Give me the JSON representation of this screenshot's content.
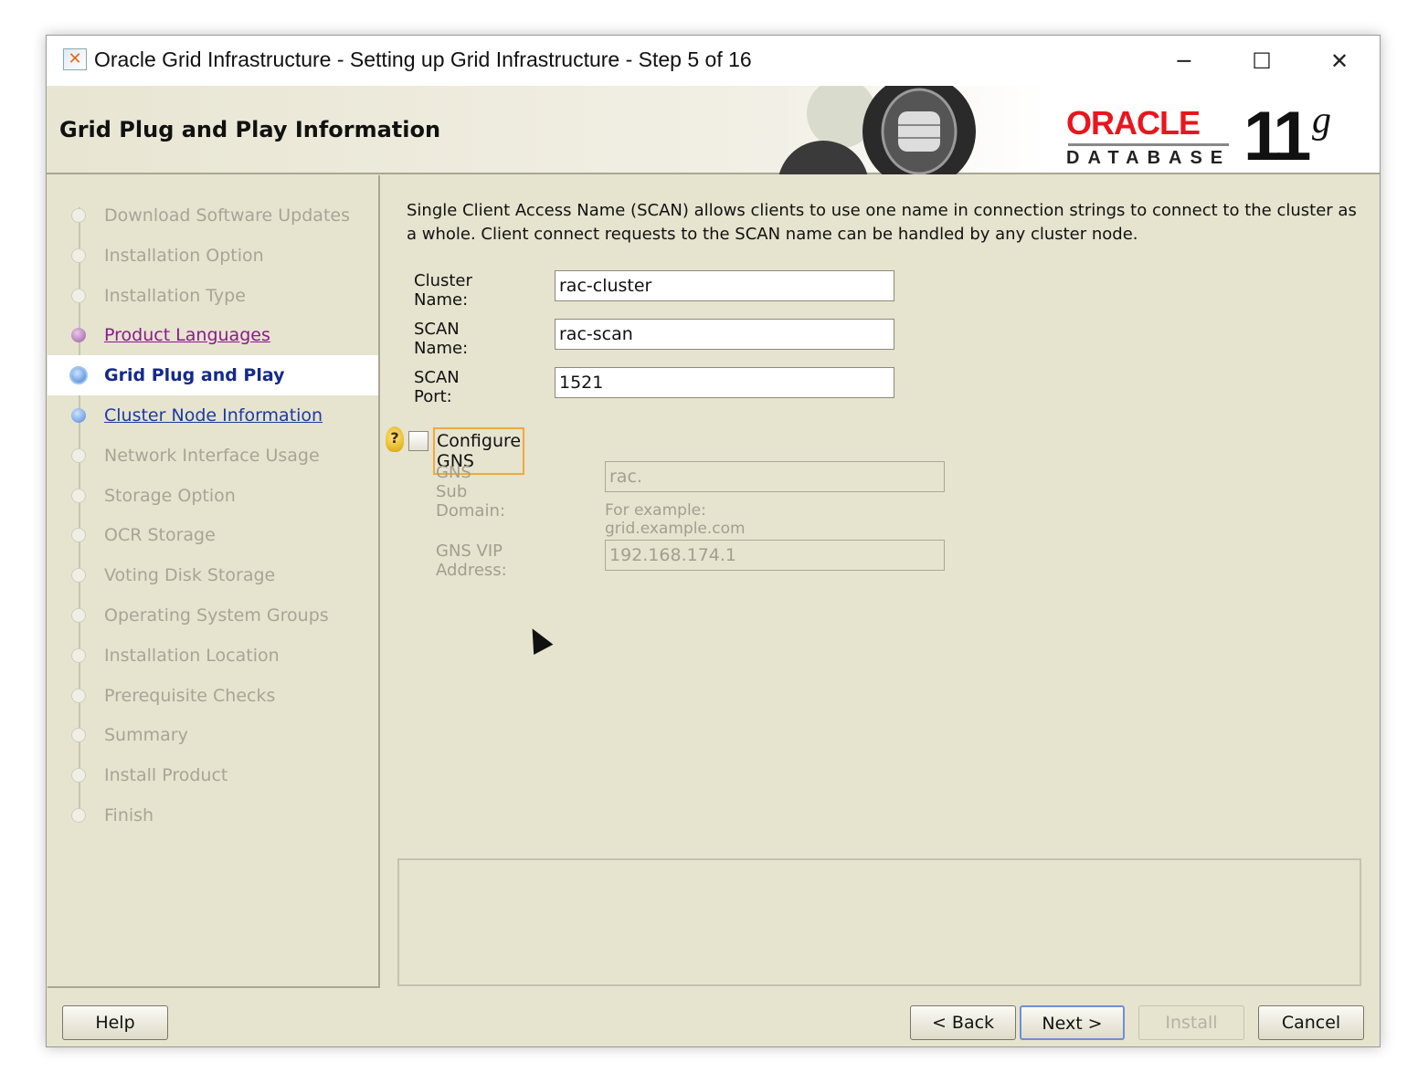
{
  "window": {
    "title": "Oracle Grid Infrastructure - Setting up Grid Infrastructure - Step 5 of 16",
    "minimize": "─",
    "maximize": "☐",
    "close": "✕"
  },
  "header": {
    "title": "Grid Plug and Play Information",
    "logo_brand": "ORACLE",
    "logo_product": "DATABASE",
    "logo_version": "11",
    "logo_suffix": "g"
  },
  "steps": [
    {
      "label": "Download Software Updates",
      "state": "done"
    },
    {
      "label": "Installation Option",
      "state": "done"
    },
    {
      "label": "Installation Type",
      "state": "done"
    },
    {
      "label": "Product Languages",
      "state": "visited"
    },
    {
      "label": "Grid Plug and Play",
      "state": "current"
    },
    {
      "label": "Cluster Node Information",
      "state": "next"
    },
    {
      "label": "Network Interface Usage",
      "state": "pending"
    },
    {
      "label": "Storage Option",
      "state": "pending"
    },
    {
      "label": "OCR Storage",
      "state": "pending"
    },
    {
      "label": "Voting Disk Storage",
      "state": "pending"
    },
    {
      "label": "Operating System Groups",
      "state": "pending"
    },
    {
      "label": "Installation Location",
      "state": "pending"
    },
    {
      "label": "Prerequisite Checks",
      "state": "pending"
    },
    {
      "label": "Summary",
      "state": "pending"
    },
    {
      "label": "Install Product",
      "state": "pending"
    },
    {
      "label": "Finish",
      "state": "pending"
    }
  ],
  "form": {
    "description": "Single Client Access Name (SCAN) allows clients to use one name in connection strings to connect to the cluster as a whole. Client connect requests to the SCAN name can be handled by any cluster node.",
    "cluster_name_label": "Cluster Name:",
    "cluster_name": "rac-cluster",
    "scan_name_label": "SCAN Name:",
    "scan_name": "rac-scan",
    "scan_port_label": "SCAN Port:",
    "scan_port": "1521",
    "configure_gns_label": "Configure GNS",
    "configure_gns_checked": false,
    "gns_subdomain_label": "GNS Sub Domain:",
    "gns_subdomain": "rac.",
    "gns_example": "For example: grid.example.com",
    "gns_vip_label": "GNS VIP Address:",
    "gns_vip": "192.168.174.1"
  },
  "buttons": {
    "help": "Help",
    "back": "< Back",
    "next": "Next >",
    "install": "Install",
    "cancel": "Cancel"
  }
}
